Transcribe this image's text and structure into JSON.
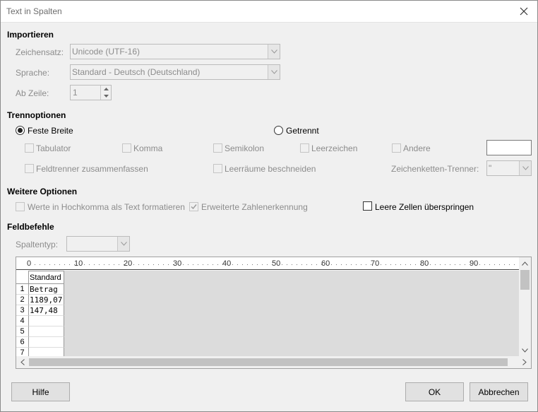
{
  "window": {
    "title": "Text in Spalten"
  },
  "import": {
    "heading": "Importieren",
    "charset_label": "Zeichensatz:",
    "charset_value": "Unicode (UTF-16)",
    "language_label": "Sprache:",
    "language_value": "Standard - Deutsch (Deutschland)",
    "fromrow_label": "Ab Zeile:",
    "fromrow_value": "1"
  },
  "separator": {
    "heading": "Trennoptionen",
    "fixed_width": "Feste Breite",
    "separated": "Getrennt",
    "tab": "Tabulator",
    "comma": "Komma",
    "semicolon": "Semikolon",
    "space": "Leerzeichen",
    "other": "Andere",
    "merge_delimiters": "Feldtrenner zusammenfassen",
    "trim_spaces": "Leerräume beschneiden",
    "string_delimiter_label": "Zeichenketten-Trenner:",
    "string_delimiter_value": "\""
  },
  "other_options": {
    "heading": "Weitere Optionen",
    "quoted_as_text": "Werte in Hochkomma als Text formatieren",
    "detect_special_numbers": "Erweiterte Zahlenerkennung",
    "skip_empty_cells": "Leere Zellen überspringen"
  },
  "fields": {
    "heading": "Feldbefehle",
    "column_type_label": "Spaltentyp:",
    "column_type_value": ""
  },
  "preview": {
    "ruler_ticks": [
      "0",
      "10",
      "20",
      "30",
      "40",
      "50",
      "60",
      "70",
      "80",
      "90"
    ],
    "column_header": "Standard",
    "rows": [
      {
        "num": "1",
        "value": "Betrag"
      },
      {
        "num": "2",
        "value": "1189,07"
      },
      {
        "num": "3",
        "value": "147,48"
      },
      {
        "num": "4",
        "value": ""
      },
      {
        "num": "5",
        "value": ""
      },
      {
        "num": "6",
        "value": ""
      },
      {
        "num": "7",
        "value": ""
      }
    ]
  },
  "buttons": {
    "help": "Hilfe",
    "ok": "OK",
    "cancel": "Abbrechen"
  }
}
